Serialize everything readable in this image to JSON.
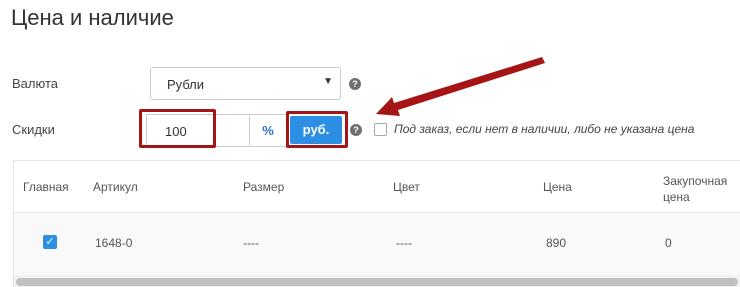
{
  "section": {
    "title": "Цена и наличие"
  },
  "currency": {
    "label": "Валюта",
    "selected": "Рубли",
    "arrow": "▼"
  },
  "discount": {
    "label": "Скидки",
    "value": "100",
    "percent_label": "%",
    "rub_label": "руб."
  },
  "help_icon": "?",
  "on_order": {
    "label": "Под заказ, если нет в наличии, либо не указана цена"
  },
  "table": {
    "headers": [
      "Главная",
      "Артикул",
      "Размер",
      "Цвет",
      "Цена",
      "Закупочная\nцена"
    ],
    "rows": [
      {
        "main": true,
        "sku": "1648-0",
        "size": "----",
        "color": "----",
        "price": "890",
        "purchase_price": "0"
      }
    ]
  },
  "colors": {
    "accent": "#2c8fe3",
    "highlight": "#a51515"
  }
}
